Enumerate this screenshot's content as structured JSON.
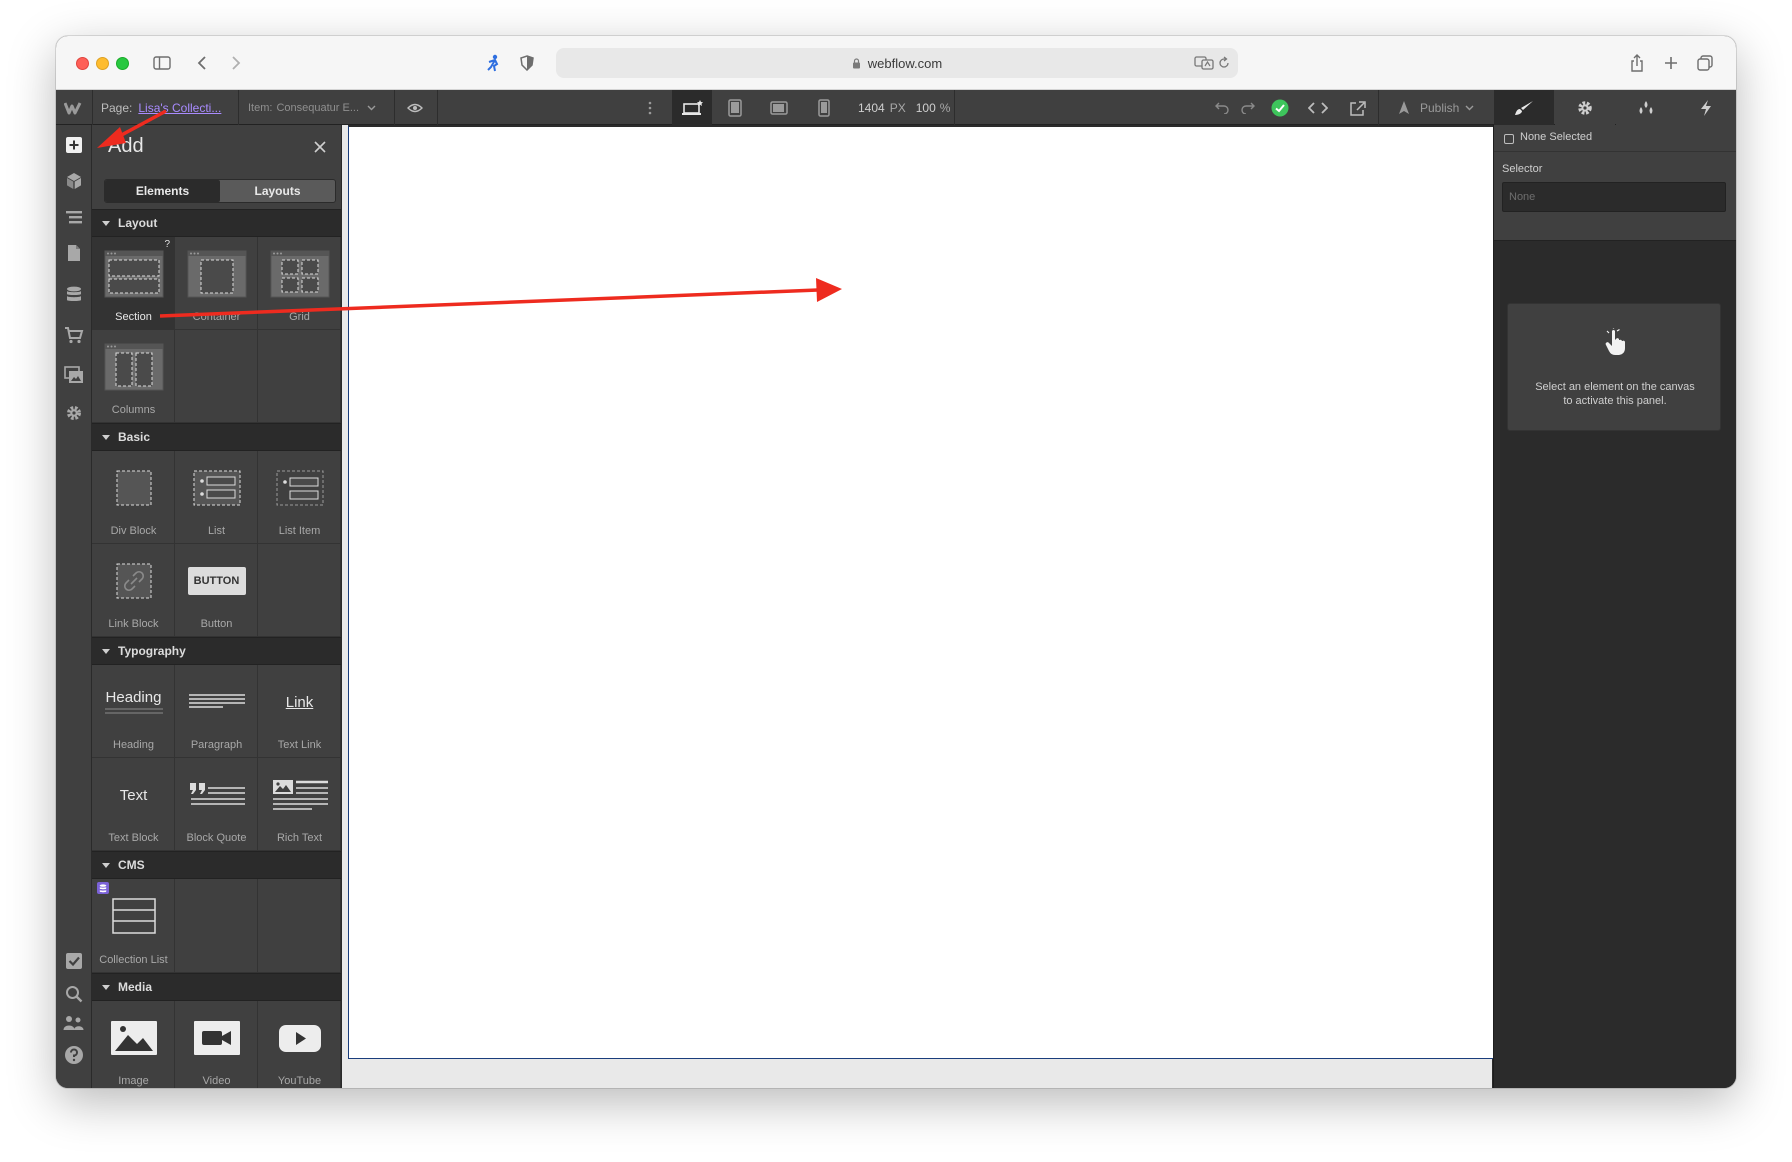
{
  "browser": {
    "url": "webflow.com"
  },
  "topbar": {
    "page_label": "Page:",
    "page_name": "Lisa's Collecti...",
    "item_label": "Item:",
    "item_name": "Consequatur E...",
    "width_value": "1404",
    "width_unit": "PX",
    "zoom_value": "100",
    "zoom_unit": "%",
    "publish_label": "Publish"
  },
  "add_panel": {
    "title": "Add",
    "tabs": [
      "Elements",
      "Layouts"
    ],
    "active_tab": "Elements",
    "sections": {
      "layout": {
        "title": "Layout",
        "items": [
          "Section",
          "Container",
          "Grid",
          "Columns"
        ]
      },
      "basic": {
        "title": "Basic",
        "items": [
          "Div Block",
          "List",
          "List Item",
          "Link Block",
          "Button"
        ]
      },
      "typography": {
        "title": "Typography",
        "items": [
          "Heading",
          "Paragraph",
          "Text Link",
          "Text Block",
          "Block Quote",
          "Rich Text"
        ]
      },
      "cms": {
        "title": "CMS",
        "items": [
          "Collection List"
        ]
      },
      "media": {
        "title": "Media",
        "items": [
          "Image",
          "Video",
          "YouTube"
        ]
      }
    },
    "icon_text": {
      "button": "BUTTON",
      "heading": "Heading",
      "link": "Link",
      "text": "Text",
      "help": "?"
    }
  },
  "style_panel": {
    "none_selected": "None Selected",
    "selector_label": "Selector",
    "selector_placeholder": "None",
    "empty_message_line1": "Select an element on the canvas",
    "empty_message_line2": "to activate this panel."
  },
  "colors": {
    "accent_purple": "#a98bff",
    "success_green": "#3ec55c",
    "annotation_red": "#ee2b1f"
  }
}
